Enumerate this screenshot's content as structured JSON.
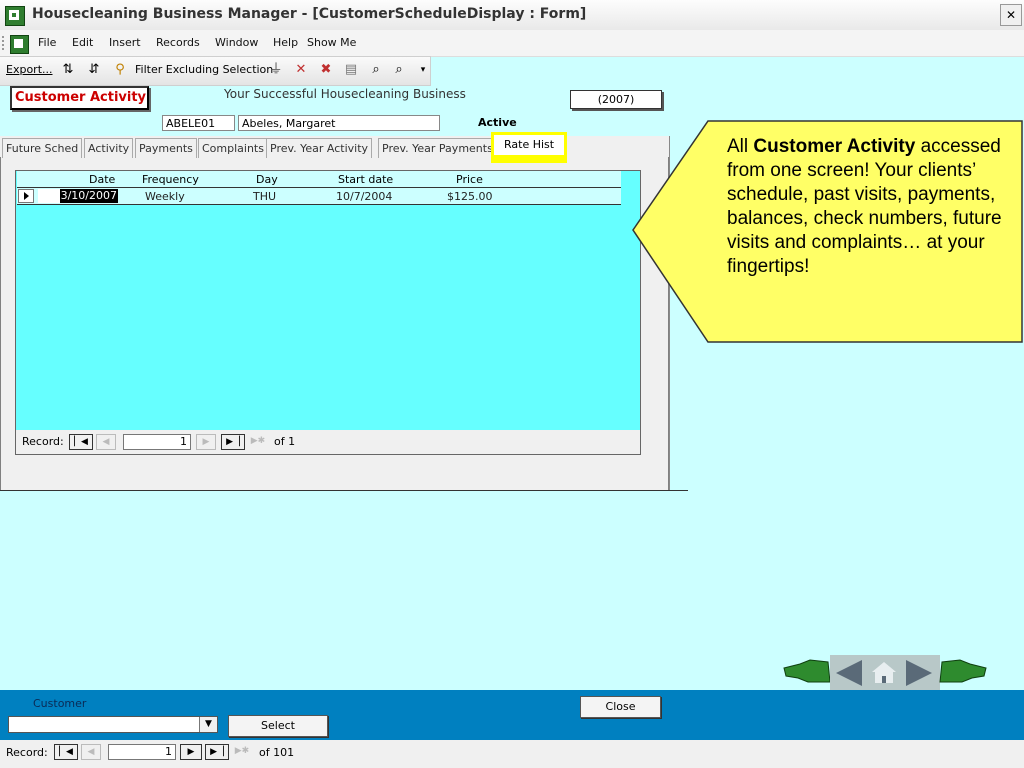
{
  "window": {
    "title": "Housecleaning Business Manager - [CustomerScheduleDisplay : Form]",
    "close_glyph": "✕"
  },
  "menu": [
    "File",
    "Edit",
    "Insert",
    "Records",
    "Window",
    "Help",
    "Show Me"
  ],
  "toolbar": {
    "export_label": "Export...",
    "filter_label": "Filter Excluding Selection"
  },
  "form": {
    "title": "Customer Activity",
    "business_name": "Your Successful Housecleaning Business",
    "year": "(2007)",
    "customer_id": "ABELE01",
    "customer_name": "Abeles, Margaret",
    "status": "Active"
  },
  "tabs": [
    "Future Sched",
    "Activity",
    "Payments",
    "Complaints",
    "Prev. Year  Activity",
    "Prev. Year Payments",
    "Rate Hist"
  ],
  "active_tab": "Rate Hist",
  "rate_table": {
    "columns": [
      "Date",
      "Frequency",
      "Day",
      "Start date",
      "Price"
    ],
    "rows": [
      {
        "date": "3/10/2007",
        "frequency": "Weekly",
        "day": "THU",
        "start_date": "10/7/2004",
        "price": "$125.00"
      }
    ]
  },
  "subform_nav": {
    "label": "Record:",
    "current": "1",
    "of_text": "of  1"
  },
  "callout": {
    "prefix": "All ",
    "bold": "Customer Activity",
    "text": "accessed from one screen! Your clients’ schedule, past visits, payments, balances, check numbers, future visits and complaints… at your fingertips!"
  },
  "bottom": {
    "customer_label": "Customer",
    "select_label": "Select",
    "close_label": "Close"
  },
  "main_nav": {
    "label": "Record:",
    "current": "1",
    "of_text": "of  101"
  },
  "colors": {
    "form_bg": "#ccffff",
    "subform_bg": "#66ffff",
    "bottom_bar": "#0080c0",
    "callout": "#ffff66",
    "title_red": "#cc0000",
    "highlight": "#ffff00"
  }
}
